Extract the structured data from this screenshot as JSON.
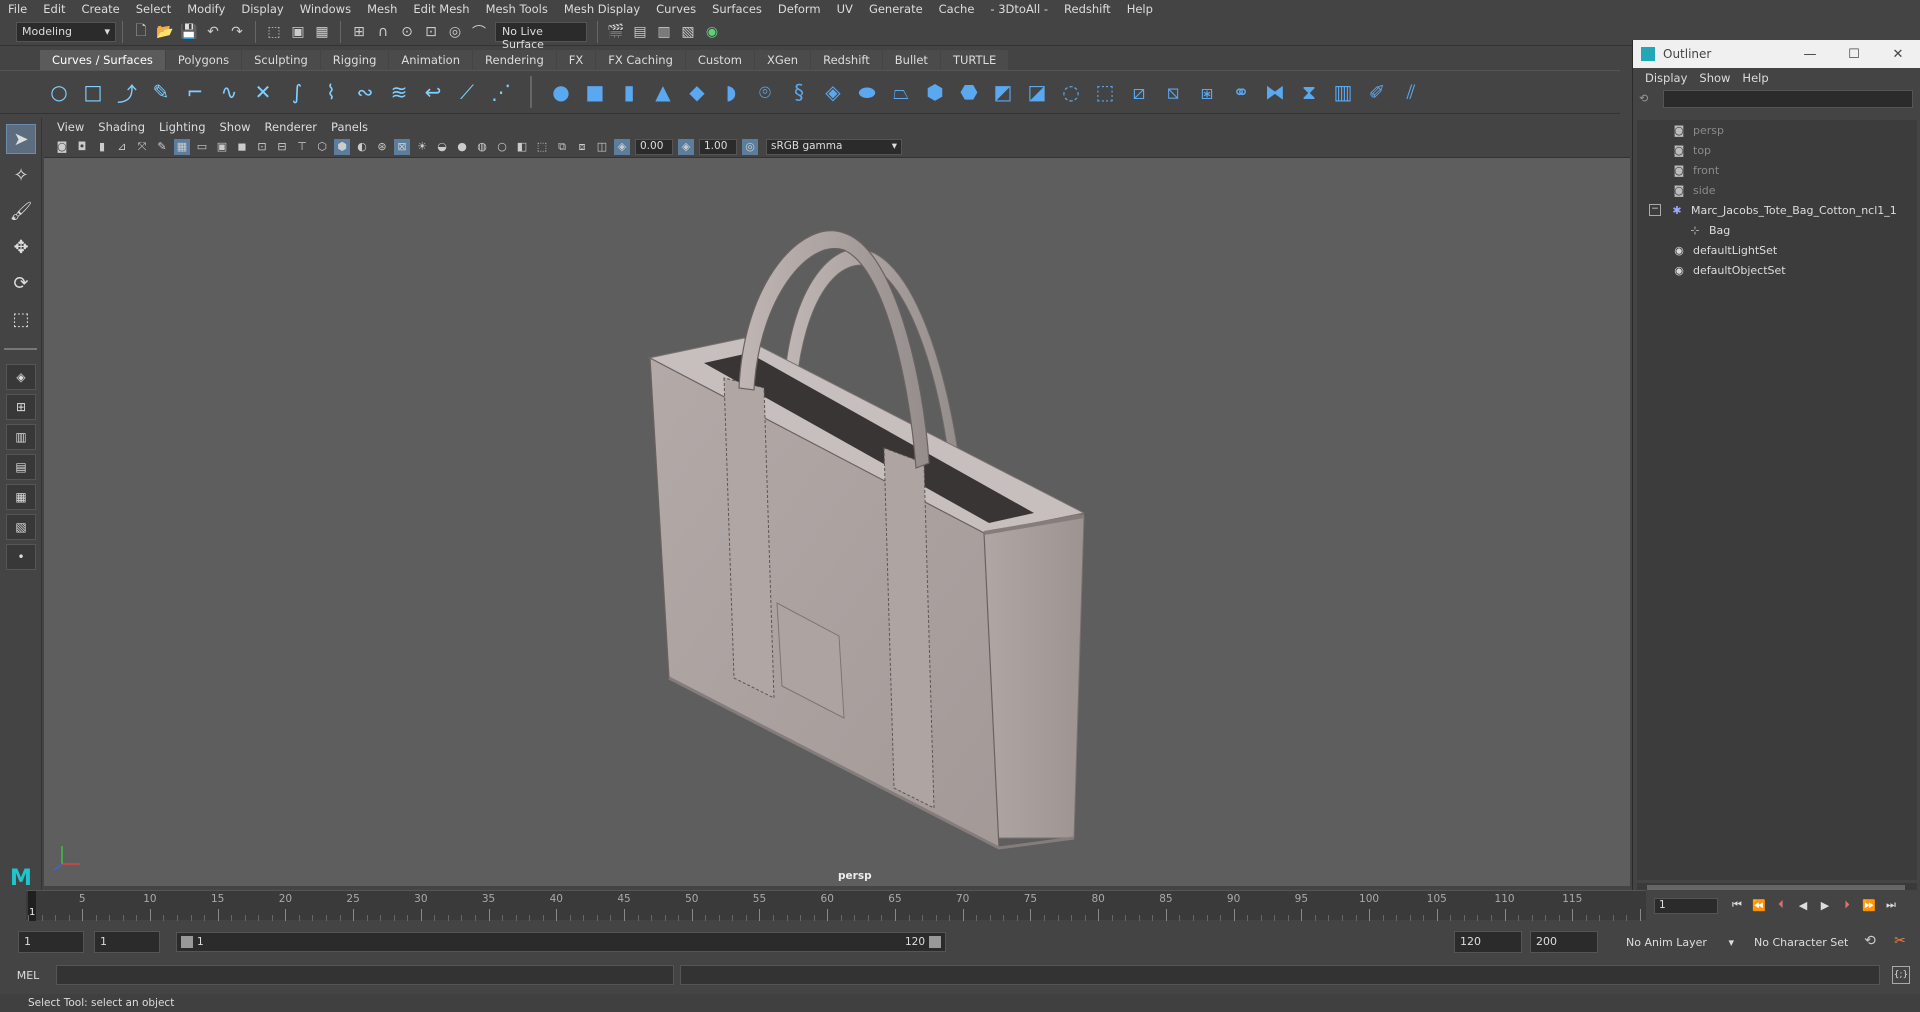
{
  "menu": [
    "File",
    "Edit",
    "Create",
    "Select",
    "Modify",
    "Display",
    "Windows",
    "Mesh",
    "Edit Mesh",
    "Mesh Tools",
    "Mesh Display",
    "Curves",
    "Surfaces",
    "Deform",
    "UV",
    "Generate",
    "Cache",
    "- 3DtoAll -",
    "Redshift",
    "Help"
  ],
  "status_line": {
    "mode": "Modeling",
    "live_surface": "No Live Surface"
  },
  "shelf_tabs": [
    "Curves / Surfaces",
    "Polygons",
    "Sculpting",
    "Rigging",
    "Animation",
    "Rendering",
    "FX",
    "FX Caching",
    "Custom",
    "XGen",
    "Redshift",
    "Bullet",
    "TURTLE"
  ],
  "shelf_tab_active": "Curves / Surfaces",
  "viewport": {
    "menu": [
      "View",
      "Shading",
      "Lighting",
      "Show",
      "Renderer",
      "Panels"
    ],
    "exposure": "0.00",
    "gamma": "1.00",
    "color_space": "sRGB gamma",
    "camera_label": "persp"
  },
  "outliner": {
    "title": "Outliner",
    "menu": [
      "Display",
      "Show",
      "Help"
    ],
    "items": [
      {
        "label": "persp",
        "icon": "camera-icon",
        "dim": true
      },
      {
        "label": "top",
        "icon": "camera-icon",
        "dim": true
      },
      {
        "label": "front",
        "icon": "camera-icon",
        "dim": true
      },
      {
        "label": "side",
        "icon": "camera-icon",
        "dim": true
      },
      {
        "label": "Marc_Jacobs_Tote_Bag_Cotton_ncl1_1",
        "icon": "group-icon",
        "dim": false
      },
      {
        "label": "Bag",
        "icon": "mesh-icon",
        "dim": false
      },
      {
        "label": "defaultLightSet",
        "icon": "set-icon",
        "dim": false
      },
      {
        "label": "defaultObjectSet",
        "icon": "set-icon",
        "dim": false
      }
    ]
  },
  "timeline": {
    "ticks": [
      1,
      5,
      10,
      15,
      20,
      25,
      30,
      35,
      40,
      45,
      50,
      55,
      60,
      65,
      70,
      75,
      80,
      85,
      90,
      95,
      100,
      105,
      110,
      115
    ],
    "current_frame": "1",
    "current_field": "1"
  },
  "range": {
    "start": "1",
    "playback_start": "1",
    "range_start_label": "1",
    "range_end_label": "120",
    "playback_end": "120",
    "end": "200",
    "anim_layer": "No Anim Layer",
    "character_set": "No Character Set"
  },
  "command_line": {
    "label": "MEL"
  },
  "help_line": "Select Tool: select an object"
}
